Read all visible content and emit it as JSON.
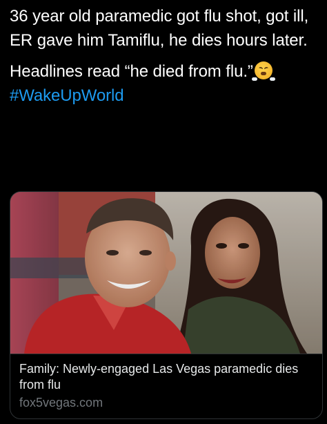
{
  "tweet": {
    "paragraph1": "36 year old paramedic got flu shot, got ill, ER gave him Tamiflu, he dies hours later.",
    "paragraph2": "Headlines read “he died from flu.”",
    "paragraph2_emoji": "face-with-steam-from-nose-icon",
    "hashtag": "#WakeUpWorld"
  },
  "link_card": {
    "title": "Family: Newly-engaged Las Vegas paramedic dies from flu",
    "domain": "fox5vegas.com",
    "image_icon": "photo-of-smiling-couple"
  },
  "colors": {
    "background": "#000000",
    "text": "#ffffff",
    "link": "#1d9bf0",
    "muted": "#71767b",
    "border": "#2f3336"
  }
}
